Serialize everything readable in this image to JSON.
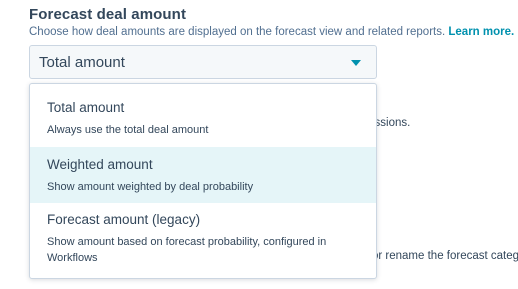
{
  "section": {
    "title": "Forecast deal amount",
    "description": "Choose how deal amounts are displayed on the forecast view and related reports.",
    "learn_more": "Learn more."
  },
  "select": {
    "value": "Total amount",
    "options": [
      {
        "label": "Total amount",
        "description": "Always use the total deal amount",
        "highlighted": false
      },
      {
        "label": "Weighted amount",
        "description": "Show amount weighted by deal probability",
        "highlighted": true
      },
      {
        "label": "Forecast amount (legacy)",
        "description": "Show amount based on forecast probability, configured in Workflows",
        "highlighted": false
      }
    ]
  },
  "background_text": {
    "line1": "issions.",
    "line2": "or rename the forecast categ"
  },
  "colors": {
    "accent": "#0091ae",
    "text": "#33475b",
    "highlight": "#e5f5f8",
    "border": "#cbd6e2"
  },
  "icons": {
    "external_link": "external-link-icon",
    "dropdown_caret": "caret-down-icon"
  }
}
